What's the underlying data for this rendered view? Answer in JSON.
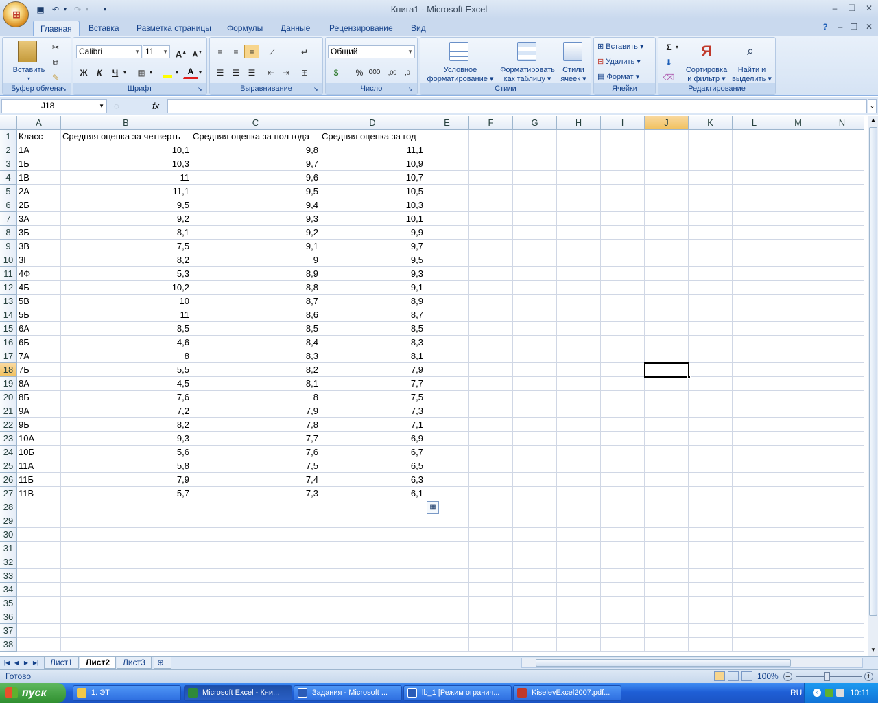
{
  "window": {
    "title": "Книга1 - Microsoft Excel"
  },
  "qat": {
    "save_icon": "save-icon",
    "undo_icon": "undo-icon",
    "redo_icon": "redo-icon"
  },
  "tabs": [
    "Главная",
    "Вставка",
    "Разметка страницы",
    "Формулы",
    "Данные",
    "Рецензирование",
    "Вид"
  ],
  "ribbon": {
    "clipboard": {
      "label": "Буфер обмена",
      "paste": "Вставить"
    },
    "font": {
      "label": "Шрифт",
      "name": "Calibri",
      "size": "11",
      "bold": "Ж",
      "italic": "К",
      "underline": "Ч"
    },
    "alignment": {
      "label": "Выравнивание"
    },
    "number": {
      "label": "Число",
      "format": "Общий"
    },
    "styles": {
      "label": "Стили",
      "conditional": [
        "Условное",
        "форматирование"
      ],
      "as_table": [
        "Форматировать",
        "как таблицу"
      ],
      "cell_styles": [
        "Стили",
        "ячеек"
      ]
    },
    "cells": {
      "label": "Ячейки",
      "insert": "Вставить",
      "delete": "Удалить",
      "format": "Формат"
    },
    "editing": {
      "label": "Редактирование",
      "sort": [
        "Сортировка",
        "и фильтр"
      ],
      "find": [
        "Найти и",
        "выделить"
      ]
    }
  },
  "formula_bar": {
    "name_box": "J18",
    "fx": "fx",
    "value": ""
  },
  "columns": [
    "A",
    "B",
    "C",
    "D",
    "E",
    "F",
    "G",
    "H",
    "I",
    "J",
    "K",
    "L",
    "M",
    "N"
  ],
  "selected_cell": {
    "column": "J",
    "row": 18
  },
  "sheet": {
    "headers": [
      "Класс",
      "Средняя оценка за четверть",
      "Средняя оценка за пол года",
      "Средняя оценка за год"
    ],
    "rows": [
      [
        "1А",
        "10,1",
        "9,8",
        "11,1"
      ],
      [
        "1Б",
        "10,3",
        "9,7",
        "10,9"
      ],
      [
        "1В",
        "11",
        "9,6",
        "10,7"
      ],
      [
        "2А",
        "11,1",
        "9,5",
        "10,5"
      ],
      [
        "2Б",
        "9,5",
        "9,4",
        "10,3"
      ],
      [
        "3А",
        "9,2",
        "9,3",
        "10,1"
      ],
      [
        "3Б",
        "8,1",
        "9,2",
        "9,9"
      ],
      [
        "3В",
        "7,5",
        "9,1",
        "9,7"
      ],
      [
        "3Г",
        "8,2",
        "9",
        "9,5"
      ],
      [
        "4Ф",
        "5,3",
        "8,9",
        "9,3"
      ],
      [
        "4Б",
        "10,2",
        "8,8",
        "9,1"
      ],
      [
        "5В",
        "10",
        "8,7",
        "8,9"
      ],
      [
        "5Б",
        "11",
        "8,6",
        "8,7"
      ],
      [
        "6А",
        "8,5",
        "8,5",
        "8,5"
      ],
      [
        "6Б",
        "4,6",
        "8,4",
        "8,3"
      ],
      [
        "7А",
        "8",
        "8,3",
        "8,1"
      ],
      [
        "7Б",
        "5,5",
        "8,2",
        "7,9"
      ],
      [
        "8А",
        "4,5",
        "8,1",
        "7,7"
      ],
      [
        "8Б",
        "7,6",
        "8",
        "7,5"
      ],
      [
        "9А",
        "7,2",
        "7,9",
        "7,3"
      ],
      [
        "9Б",
        "8,2",
        "7,8",
        "7,1"
      ],
      [
        "10А",
        "9,3",
        "7,7",
        "6,9"
      ],
      [
        "10Б",
        "5,6",
        "7,6",
        "6,7"
      ],
      [
        "11А",
        "5,8",
        "7,5",
        "6,5"
      ],
      [
        "11Б",
        "7,9",
        "7,4",
        "6,3"
      ],
      [
        "11В",
        "5,7",
        "7,3",
        "6,1"
      ]
    ],
    "row_numbers": [
      1,
      2,
      3,
      4,
      5,
      6,
      7,
      8,
      9,
      10,
      11,
      12,
      13,
      14,
      15,
      16,
      17,
      18,
      19,
      20,
      21,
      22,
      23,
      24,
      25,
      26,
      27,
      28,
      29,
      30,
      31,
      32,
      33,
      34,
      35,
      36,
      37,
      38
    ]
  },
  "sheet_tabs": [
    "Лист1",
    "Лист2",
    "Лист3"
  ],
  "active_sheet": "Лист2",
  "status": {
    "ready": "Готово",
    "zoom": "100%"
  },
  "taskbar": {
    "start": "пуск",
    "items": [
      "1. ЭТ",
      "Microsoft Excel - Кни...",
      "Задания - Microsoft ...",
      "lb_1 [Режим огранич...",
      "KiselevExcel2007.pdf..."
    ],
    "lang": "RU",
    "clock": "10:11"
  }
}
